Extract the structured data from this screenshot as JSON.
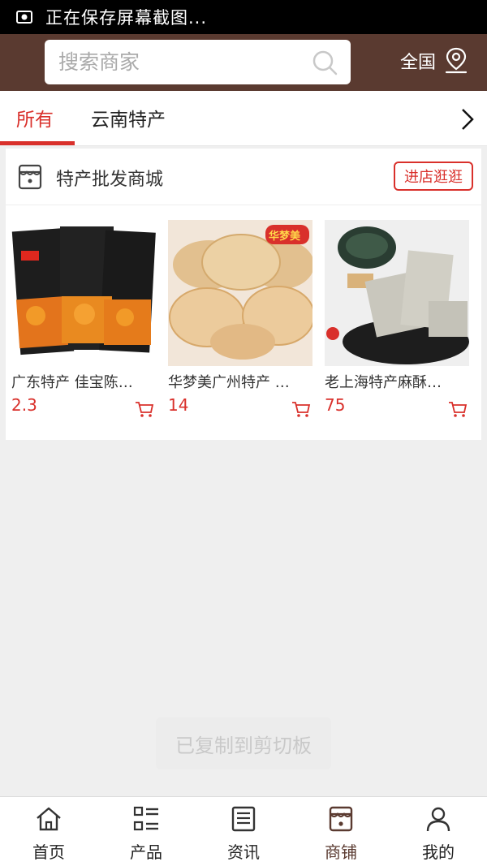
{
  "status_bar": {
    "text": "正在保存屏幕截图...",
    "icon": "screenshot-icon"
  },
  "header": {
    "search_placeholder": "搜索商家",
    "region_label": "全国",
    "bg_color": "#5a3a30"
  },
  "tabs": [
    {
      "label": "所有",
      "active": true
    },
    {
      "label": "云南特产",
      "active": false
    }
  ],
  "shop": {
    "name": "特产批发商城",
    "enter_label": "进店逛逛",
    "products": [
      {
        "name": "广东特产 佳宝陈…",
        "price": "2.3"
      },
      {
        "name": "华梦美广州特产 …",
        "price": "14",
        "brand_tag": "华梦美"
      },
      {
        "name": "老上海特产麻酥…",
        "price": "75"
      }
    ]
  },
  "toast": "已复制到剪切板",
  "bottom_nav": [
    {
      "label": "首页",
      "icon": "home-icon"
    },
    {
      "label": "产品",
      "icon": "grid-list-icon"
    },
    {
      "label": "资讯",
      "icon": "news-icon"
    },
    {
      "label": "商铺",
      "icon": "store-icon",
      "active": true
    },
    {
      "label": "我的",
      "icon": "user-icon"
    }
  ],
  "accent_color": "#d9302b"
}
